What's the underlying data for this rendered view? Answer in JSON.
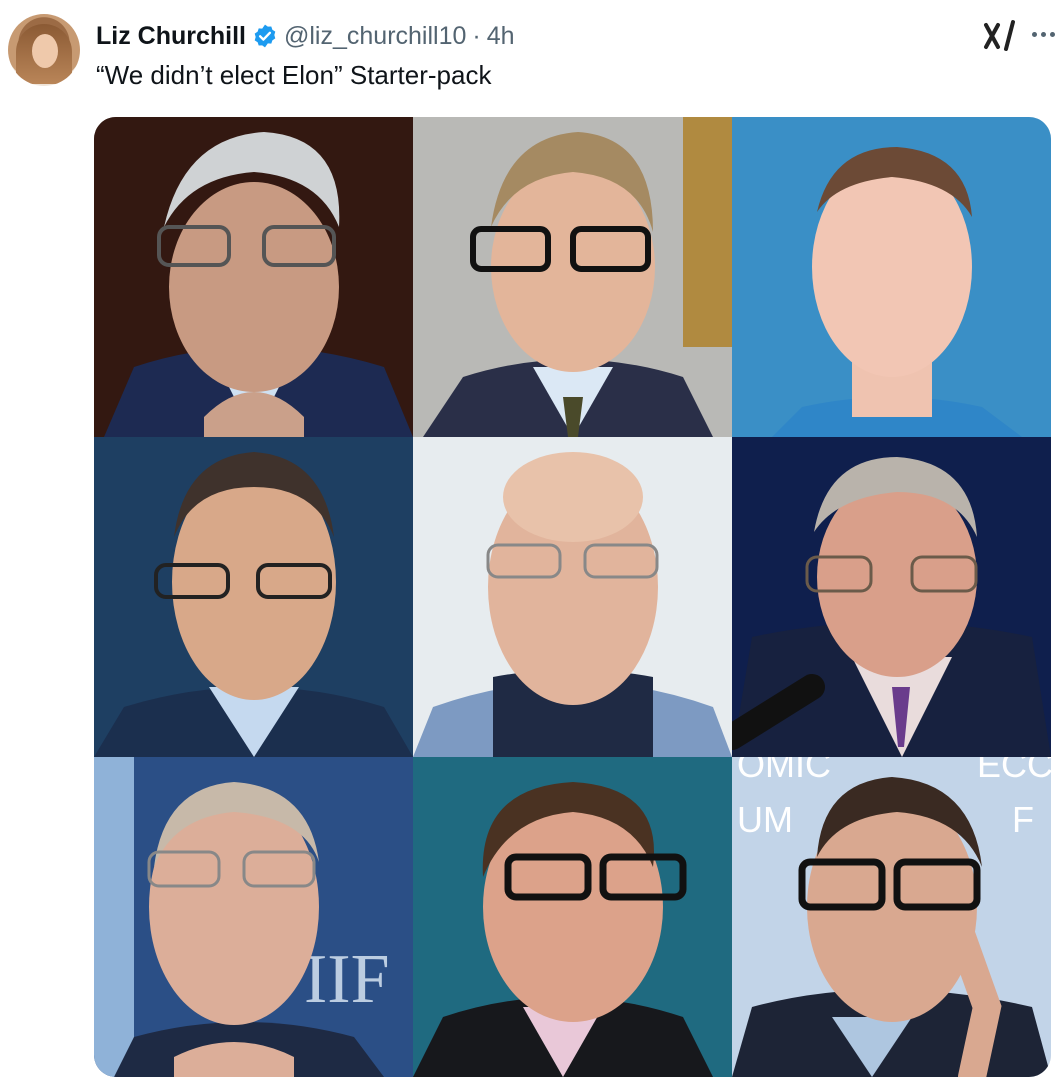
{
  "post": {
    "author_name": "Liz Churchill",
    "handle": "@liz_churchill10",
    "separator": "·",
    "time": "4h",
    "text": "“We didn’t elect Elon” Starter-pack"
  },
  "icons": {
    "verified": "verified-badge-icon",
    "grok": "grok-icon",
    "more": "more-options-icon"
  },
  "media": {
    "layout": "3x3 photo grid",
    "backdrop_lettering": {
      "cell_7": "IIF",
      "cell_9_line1": "OMIC",
      "cell_9_line2": "UM",
      "cell_9_line3": "ECC",
      "cell_9_line4": "F"
    }
  },
  "colors": {
    "verified": "#1d9bf0",
    "secondary_text": "#536471",
    "primary_text": "#0f1419"
  }
}
